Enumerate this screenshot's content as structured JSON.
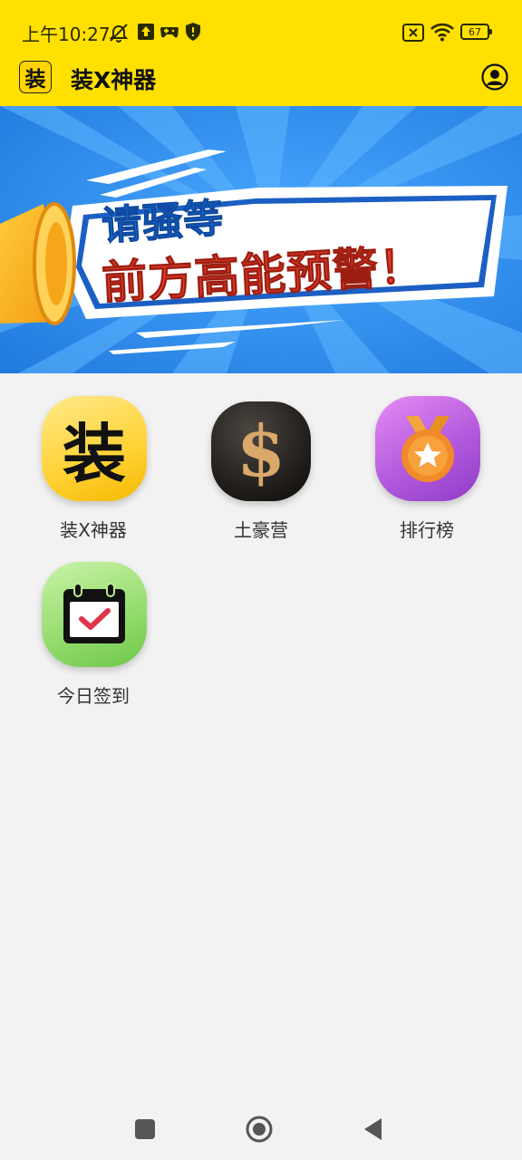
{
  "status_bar": {
    "time": "上午10:27",
    "battery": "67",
    "icons": [
      "mute-bell-icon",
      "upload-icon",
      "gamepad-icon",
      "shield-icon",
      "sim-off-icon",
      "wifi-icon",
      "battery-icon"
    ]
  },
  "app_bar": {
    "logo_char": "装",
    "title": "装X神器",
    "right_icon": "profile-icon"
  },
  "banner": {
    "line1": "请骚等",
    "line2": "前方高能预警！",
    "colors": {
      "bg": "#2f8be8",
      "text_line1": "#1f6fd6",
      "text_line2": "#e8402e"
    }
  },
  "tiles": [
    {
      "label": "装X神器",
      "glyph": "装",
      "icon": "zhuang-app-icon"
    },
    {
      "label": "土豪营",
      "glyph": "$",
      "icon": "dollar-icon"
    },
    {
      "label": "排行榜",
      "glyph": "★",
      "icon": "medal-icon"
    },
    {
      "label": "今日签到",
      "glyph": "✓",
      "icon": "calendar-check-icon"
    }
  ],
  "nav_bar": {
    "buttons": [
      "recents-button",
      "home-button",
      "back-button"
    ]
  }
}
